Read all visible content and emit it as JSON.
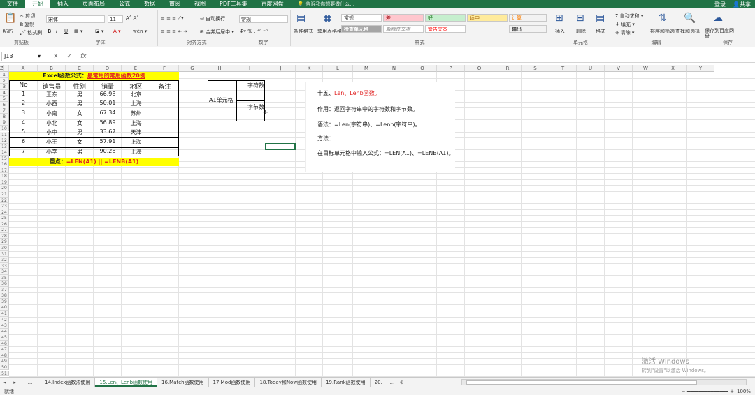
{
  "ribbon_tabs": [
    "文件",
    "开始",
    "插入",
    "页面布局",
    "公式",
    "数据",
    "审阅",
    "视图",
    "PDF工具集",
    "百度网盘"
  ],
  "tell_me": "告诉我你想要做什么...",
  "user": {
    "login": "登录",
    "share": "共享"
  },
  "clipboard": {
    "paste": "粘贴",
    "cut": "剪切",
    "copy": "复制",
    "format_painter": "格式刷",
    "label": "剪贴板"
  },
  "font": {
    "name": "宋体",
    "size": "11",
    "label": "字体",
    "bold": "B",
    "italic": "I",
    "underline": "U"
  },
  "alignment": {
    "wrap": "自动换行",
    "merge": "合并后居中",
    "label": "对齐方式"
  },
  "number": {
    "format": "常规",
    "label": "数字"
  },
  "styles": {
    "conditional": "条件格式",
    "table_format": "套用表格格式",
    "cells": [
      "常规",
      "差",
      "好",
      "适中",
      "检查单元格",
      "解释性文本",
      "警告文本",
      "计算",
      "输出"
    ],
    "label": "样式"
  },
  "cells_group": {
    "insert": "插入",
    "delete": "删除",
    "format": "格式",
    "label": "单元格"
  },
  "editing": {
    "autosum": "自动求和",
    "fill": "填充",
    "clear": "清除",
    "sort": "排序和筛选",
    "find": "查找和选择",
    "label": "编辑"
  },
  "save_group": {
    "save": "保存到百度网盘",
    "label": "保存"
  },
  "name_box": "J13",
  "formula_icons": {
    "cancel": "✕",
    "enter": "✓",
    "fx": "fx"
  },
  "columns": [
    "A",
    "B",
    "C",
    "D",
    "E",
    "F",
    "G",
    "H",
    "I",
    "J",
    "K",
    "L",
    "M",
    "N",
    "O",
    "P",
    "Q",
    "R",
    "S",
    "T",
    "U",
    "V",
    "W",
    "X",
    "Y",
    "Z"
  ],
  "title_banner": {
    "prefix": "Excel函数公式：",
    "highlight": "最常用的常用函数20例"
  },
  "table": {
    "headers": [
      "No",
      "销售员",
      "性别",
      "销量",
      "地区",
      "备注"
    ],
    "rows": [
      [
        "1",
        "王东",
        "男",
        "66.98",
        "北京"
      ],
      [
        "2",
        "小西",
        "男",
        "50.01",
        "上海"
      ],
      [
        "3",
        "小南",
        "女",
        "67.34",
        "苏州"
      ],
      [
        "4",
        "小北",
        "女",
        "56.89",
        "上海"
      ],
      [
        "5",
        "小中",
        "男",
        "33.67",
        "天津"
      ],
      [
        "6",
        "小王",
        "女",
        "57.91",
        "上海"
      ],
      [
        "7",
        "小李",
        "男",
        "90.28",
        "上海"
      ]
    ]
  },
  "bottom_banner": {
    "prefix": "重点：",
    "formula": "=LEN(A1) || =LENB(A1)"
  },
  "a1_box": {
    "label": "A1单元格",
    "char_count": "字符数",
    "byte_count": "字节数"
  },
  "notes": {
    "title_prefix": "十五、",
    "title_highlight": "Len、Lenb函数。",
    "purpose": "作用：返回字符串中的字符数和字节数。",
    "syntax": "语法：=Len(字符串)、=Lenb(字符串)。",
    "method": "方法：",
    "step": "在目标单元格中输入公式：=LEN(A1)、=LENB(A1)。"
  },
  "sheet_tabs": [
    "14.Index函数法使用",
    "15.Len、Lenb函数使用",
    "16.Match函数使用",
    "17.Mod函数使用",
    "18.Today和Now函数使用",
    "19.Rank函数使用",
    "20."
  ],
  "status": {
    "mode": "就绪",
    "zoom": "100%"
  },
  "watermark": {
    "line1": "激活 Windows",
    "line2": "转到\"设置\"以激活 Windows。"
  },
  "colors": {
    "excel_green": "#217346",
    "banner_yellow": "#ffff00",
    "highlight_red": "#e02020"
  }
}
